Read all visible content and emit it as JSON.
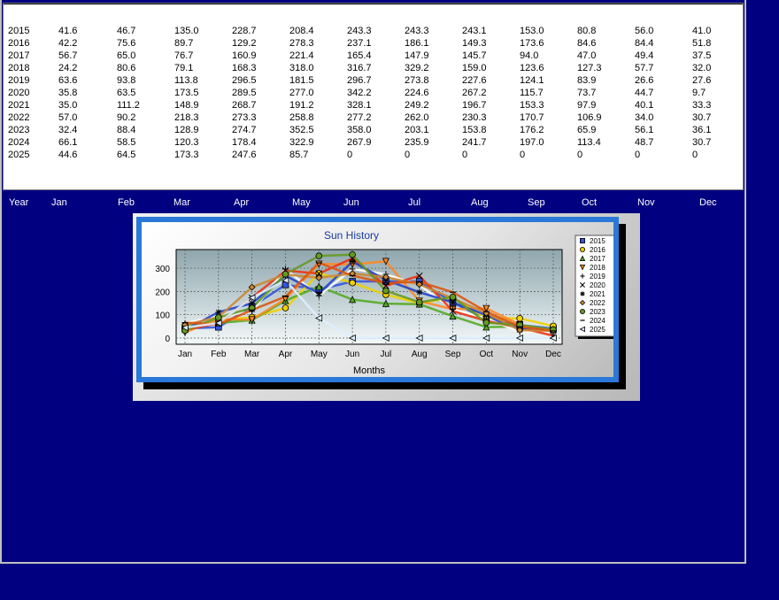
{
  "table": {
    "rows": [
      {
        "year": "2015",
        "values": [
          "41.6",
          "46.7",
          "135.0",
          "228.7",
          "208.4",
          "243.3",
          "243.3",
          "243.1",
          "153.0",
          "80.8",
          "56.0",
          "41.0"
        ]
      },
      {
        "year": "2016",
        "values": [
          "42.2",
          "75.6",
          "89.7",
          "129.2",
          "278.3",
          "237.1",
          "186.1",
          "149.3",
          "173.6",
          "84.6",
          "84.4",
          "51.8"
        ]
      },
      {
        "year": "2017",
        "values": [
          "56.7",
          "65.0",
          "76.7",
          "160.9",
          "221.4",
          "165.4",
          "147.9",
          "145.7",
          "94.0",
          "47.0",
          "49.4",
          "37.5"
        ]
      },
      {
        "year": "2018",
        "values": [
          "24.2",
          "80.6",
          "79.1",
          "168.3",
          "318.0",
          "316.7",
          "329.2",
          "159.0",
          "123.6",
          "127.3",
          "57.7",
          "32.0"
        ]
      },
      {
        "year": "2019",
        "values": [
          "63.6",
          "93.8",
          "113.8",
          "296.5",
          "181.5",
          "296.7",
          "273.8",
          "227.6",
          "124.1",
          "83.9",
          "26.6",
          "27.6"
        ]
      },
      {
        "year": "2020",
        "values": [
          "35.8",
          "63.5",
          "173.5",
          "289.5",
          "277.0",
          "342.2",
          "224.6",
          "267.2",
          "115.7",
          "73.7",
          "44.7",
          "9.7"
        ]
      },
      {
        "year": "2021",
        "values": [
          "35.0",
          "111.2",
          "148.9",
          "268.7",
          "191.2",
          "328.1",
          "249.2",
          "196.7",
          "153.3",
          "97.9",
          "40.1",
          "33.3"
        ]
      },
      {
        "year": "2022",
        "values": [
          "57.0",
          "90.2",
          "218.3",
          "273.3",
          "258.8",
          "277.2",
          "262.0",
          "230.3",
          "170.7",
          "106.9",
          "34.0",
          "30.7"
        ]
      },
      {
        "year": "2023",
        "values": [
          "32.4",
          "88.4",
          "128.9",
          "274.7",
          "352.5",
          "358.0",
          "203.1",
          "153.8",
          "176.2",
          "65.9",
          "56.1",
          "36.1"
        ]
      },
      {
        "year": "2024",
        "values": [
          "66.1",
          "58.5",
          "120.3",
          "178.4",
          "322.9",
          "267.9",
          "235.9",
          "241.7",
          "197.0",
          "113.4",
          "48.7",
          "30.7"
        ]
      },
      {
        "year": "2025",
        "values": [
          "44.6",
          "64.5",
          "173.3",
          "247.6",
          "85.7",
          "0",
          "0",
          "0",
          "0",
          "0",
          "0",
          "0"
        ]
      }
    ]
  },
  "header": {
    "year_label": "Year",
    "months": [
      "Jan",
      "Feb",
      "Mar",
      "Apr",
      "May",
      "Jun",
      "Jul",
      "Aug",
      "Sep",
      "Oct",
      "Nov",
      "Dec"
    ]
  },
  "chart_data": {
    "type": "line",
    "title": "Sun History",
    "xlabel": "Months",
    "ylabel": "",
    "categories": [
      "Jan",
      "Feb",
      "Mar",
      "Apr",
      "May",
      "Jun",
      "Jul",
      "Aug",
      "Sep",
      "Oct",
      "Nov",
      "Dec"
    ],
    "yticks": [
      "0",
      "100",
      "200",
      "300"
    ],
    "ylim": [
      0,
      380
    ],
    "grid": true,
    "legend_position": "right",
    "series": [
      {
        "name": "2015",
        "color": "#3355dd",
        "marker": "square",
        "values": [
          41.6,
          46.7,
          135.0,
          228.7,
          208.4,
          243.3,
          243.3,
          243.1,
          153.0,
          80.8,
          56.0,
          41.0
        ]
      },
      {
        "name": "2016",
        "color": "#f0d000",
        "marker": "circle",
        "values": [
          42.2,
          75.6,
          89.7,
          129.2,
          278.3,
          237.1,
          186.1,
          149.3,
          173.6,
          84.6,
          84.4,
          51.8
        ]
      },
      {
        "name": "2017",
        "color": "#55aa22",
        "marker": "triangle",
        "values": [
          56.7,
          65.0,
          76.7,
          160.9,
          221.4,
          165.4,
          147.9,
          145.7,
          94.0,
          47.0,
          49.4,
          37.5
        ]
      },
      {
        "name": "2018",
        "color": "#ff8822",
        "marker": "triangle-down",
        "values": [
          24.2,
          80.6,
          79.1,
          168.3,
          318.0,
          316.7,
          329.2,
          159.0,
          123.6,
          127.3,
          57.7,
          32.0
        ]
      },
      {
        "name": "2019",
        "color": "#ffffff",
        "marker": "plus",
        "values": [
          63.6,
          93.8,
          113.8,
          296.5,
          181.5,
          296.7,
          273.8,
          227.6,
          124.1,
          83.9,
          26.6,
          27.6
        ]
      },
      {
        "name": "2020",
        "color": "#ee3311",
        "marker": "x",
        "values": [
          35.8,
          63.5,
          173.5,
          289.5,
          277.0,
          342.2,
          224.6,
          267.2,
          115.7,
          73.7,
          44.7,
          9.7
        ]
      },
      {
        "name": "2021",
        "color": "#2244cc",
        "marker": "star",
        "values": [
          35.0,
          111.2,
          148.9,
          268.7,
          191.2,
          328.1,
          249.2,
          196.7,
          153.3,
          97.9,
          40.1,
          33.3
        ]
      },
      {
        "name": "2022",
        "color": "#cc8833",
        "marker": "diamond",
        "values": [
          57.0,
          90.2,
          218.3,
          273.3,
          258.8,
          277.2,
          262.0,
          230.3,
          170.7,
          106.9,
          34.0,
          30.7
        ]
      },
      {
        "name": "2023",
        "color": "#669922",
        "marker": "circle",
        "values": [
          32.4,
          88.4,
          128.9,
          274.7,
          352.5,
          358.0,
          203.1,
          153.8,
          176.2,
          65.9,
          56.1,
          36.1
        ]
      },
      {
        "name": "2024",
        "color": "#dd5511",
        "marker": "line",
        "values": [
          66.1,
          58.5,
          120.3,
          178.4,
          322.9,
          267.9,
          235.9,
          241.7,
          197.0,
          113.4,
          48.7,
          30.7
        ]
      },
      {
        "name": "2025",
        "color": "#ddeeff",
        "marker": "triangle-left",
        "values": [
          44.6,
          64.5,
          173.3,
          247.6,
          85.7,
          0,
          0,
          0,
          0,
          0,
          0,
          0
        ]
      }
    ]
  }
}
